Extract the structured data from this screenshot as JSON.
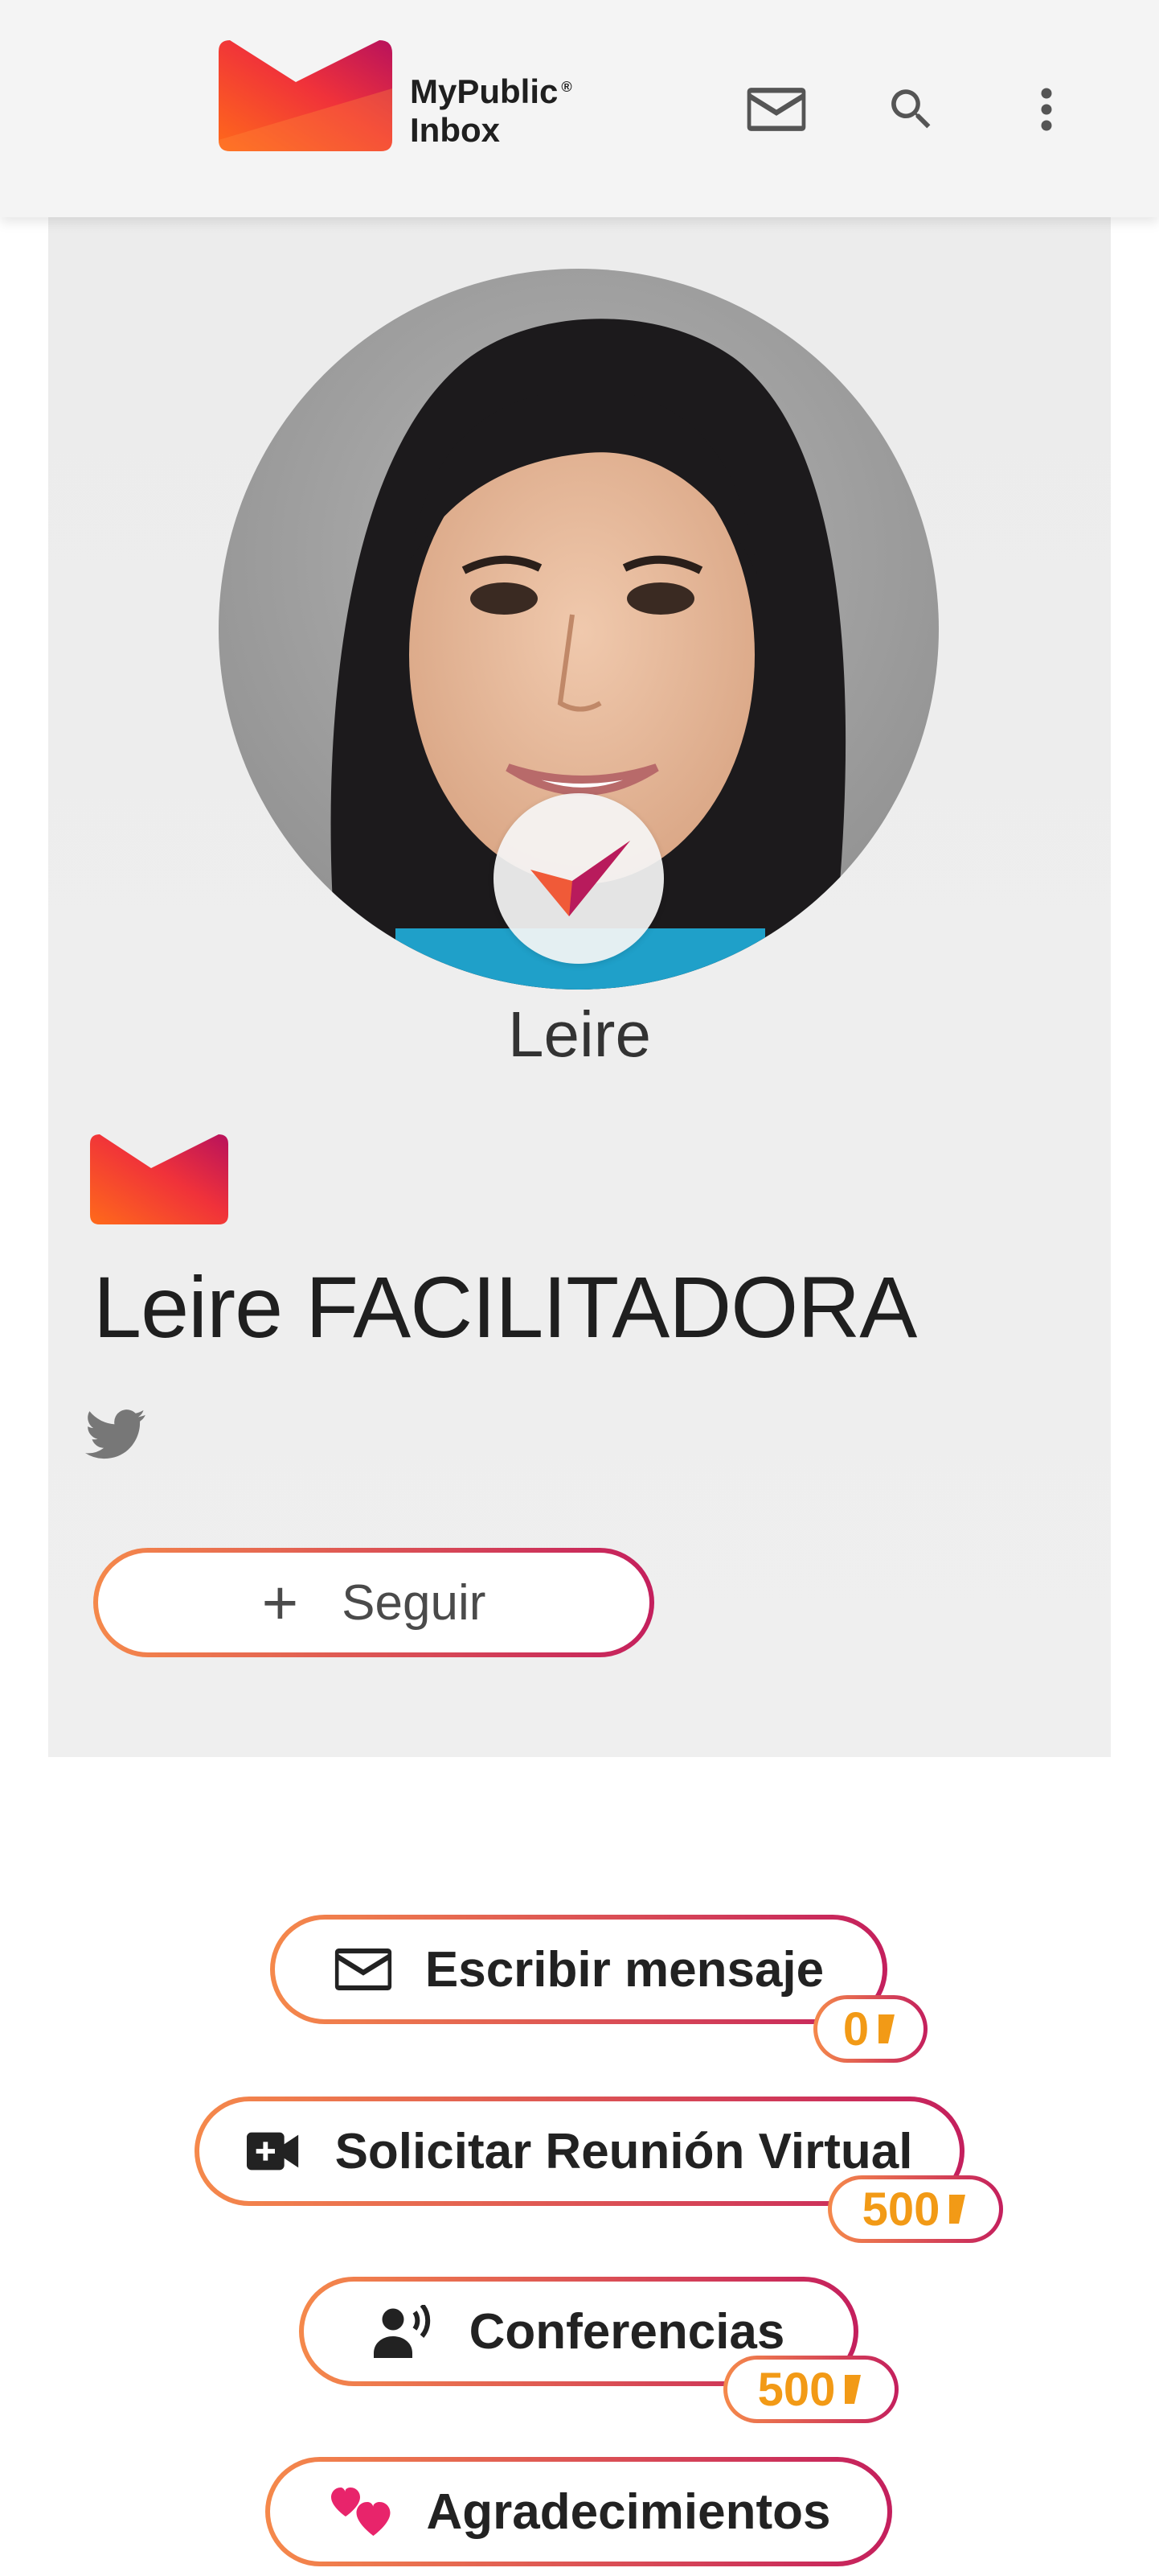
{
  "header": {
    "brand_line1": "MyPublic",
    "brand_reg": "®",
    "brand_line2": "Inbox",
    "icons": [
      "mail-icon",
      "search-icon",
      "more-vert-icon"
    ]
  },
  "profile": {
    "short_name": "Leire",
    "full_name": "Leire FACILITADORA",
    "social": [
      "twitter-icon"
    ],
    "follow_label": "Seguir"
  },
  "actions": [
    {
      "label": "Escribir mensaje",
      "icon": "mail-icon",
      "price": "0"
    },
    {
      "label": "Solicitar Reunión Virtual",
      "icon": "video-add-icon",
      "price": "500"
    },
    {
      "label": "Conferencias",
      "icon": "speaker-icon",
      "price": "500"
    },
    {
      "label": "Agradecimientos",
      "icon": "hearts-icon"
    }
  ],
  "colors": {
    "accent_orange": "#f5894b",
    "accent_magenta": "#c41f5d",
    "price_text": "#f29a16",
    "header_bg": "#f4f4f4",
    "card_bg": "#ececec"
  }
}
